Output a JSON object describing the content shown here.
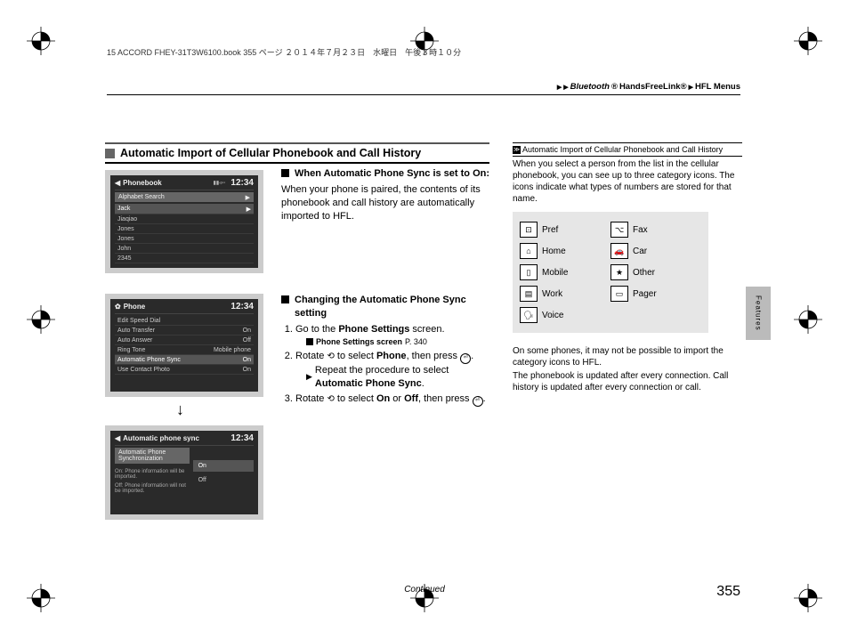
{
  "crop_mark_text": "15 ACCORD FHEY-31T3W6100.book  355 ページ  ２０１４年７月２３日　水曜日　午後３時１０分",
  "breadcrumb": {
    "bt": "Bluetooth",
    "reg": "®",
    "hfl": " HandsFreeLink®",
    "menus": "HFL Menus"
  },
  "section_title": "Automatic Import of Cellular Phonebook and Call History",
  "block1": {
    "heading": "When Automatic Phone Sync is set to On:",
    "text": "When your phone is paired, the contents of its phonebook and call history are automatically imported to HFL."
  },
  "block2": {
    "heading": "Changing the Automatic Phone Sync setting",
    "step1a": "Go to the ",
    "step1b": "Phone Settings",
    "step1c": " screen.",
    "ref": "Phone Settings screen",
    "ref_page": " P. 340",
    "step2a": "Rotate ",
    "step2b": " to select ",
    "step2c": "Phone",
    "step2d": ", then press ",
    "step2e": ".",
    "step2r1": "Repeat the procedure to select ",
    "step2r2": "Automatic Phone Sync",
    "step2r3": ".",
    "step3a": "Rotate ",
    "step3b": " to select ",
    "step3c": "On",
    "step3d": " or ",
    "step3e": "Off",
    "step3f": ", then press ",
    "step3g": "."
  },
  "side": {
    "title": "Automatic Import of Cellular Phonebook and Call History",
    "p1": "When you select a person from the list in the cellular phonebook, you can see up to three category icons. The icons indicate what types of numbers are stored for that name.",
    "p2": "On some phones, it may not be possible to import the category icons to HFL.",
    "p3": "The phonebook is updated after every connection. Call history is updated after every connection or call."
  },
  "icon_labels": {
    "pref": "Pref",
    "fax": "Fax",
    "home": "Home",
    "car": "Car",
    "mobile": "Mobile",
    "other": "Other",
    "work": "Work",
    "pager": "Pager",
    "voice": "Voice"
  },
  "screens": {
    "clock": "12:34",
    "s1_title": "Phonebook",
    "s1_rows": [
      "Alphabet Search",
      "Jack",
      "Jiaqiao",
      "Jones",
      "Jones",
      "John",
      "2345"
    ],
    "s2_title": "Phone",
    "s2_rows": [
      [
        "Edit Speed Dial",
        ""
      ],
      [
        "Auto Transfer",
        "On"
      ],
      [
        "Auto Answer",
        "Off"
      ],
      [
        "Ring Tone",
        "Mobile phone"
      ],
      [
        "Automatic Phone Sync",
        "On"
      ],
      [
        "Use Contact Photo",
        "On"
      ]
    ],
    "s3_title": "Automatic phone sync",
    "s3_sel": "Automatic Phone Synchronization",
    "s3_on_note": "On: Phone information will be imported.",
    "s3_off_note": "Off: Phone information will not be imported.",
    "s3_on": "On",
    "s3_off": "Off"
  },
  "continued": "Continued",
  "page_number": "355",
  "tab_label": "Features"
}
